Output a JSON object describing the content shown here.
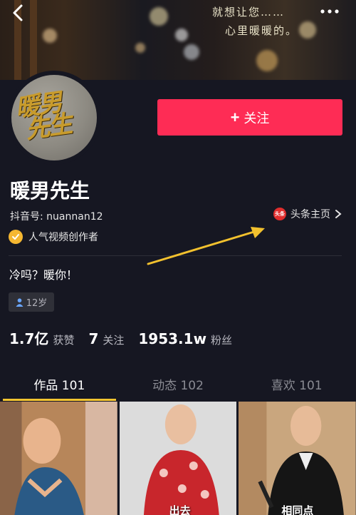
{
  "banner": {
    "caption_line1": "就想让您……",
    "caption_line2": "心里暖暖的。"
  },
  "profile": {
    "avatar_logo": "暖男先生",
    "nickname": "暖男先生",
    "uid": "抖音号: nuannan12",
    "follow_label": "关注",
    "toutiao_icon_text": "头条",
    "toutiao_label": "头条主页",
    "creator_label": "人气视频创作者",
    "bio": "冷吗？暖你！",
    "age_tag": "12岁"
  },
  "stats": {
    "likes_value": "1.7亿",
    "likes_label": "获赞",
    "following_value": "7",
    "following_label": "关注",
    "fans_value": "1953.1w",
    "fans_label": "粉丝"
  },
  "tabs": [
    {
      "label": "作品 101",
      "active": true
    },
    {
      "label": "动态 102",
      "active": false
    },
    {
      "label": "喜欢 101",
      "active": false
    }
  ],
  "videos": [
    {
      "caption": ""
    },
    {
      "caption": "出去"
    },
    {
      "caption": "相同点"
    }
  ],
  "colors": {
    "background": "#161722",
    "follow_button": "#fe2c55",
    "tab_indicator": "#f5c530",
    "annotation_arrow": "#f2c12e",
    "creator_badge": "#f5b731"
  },
  "icons": {
    "back": "back-arrow-icon",
    "more": "more-dots-icon",
    "toutiao": "toutiao-icon",
    "creator": "check-badge-icon",
    "age": "person-icon"
  }
}
